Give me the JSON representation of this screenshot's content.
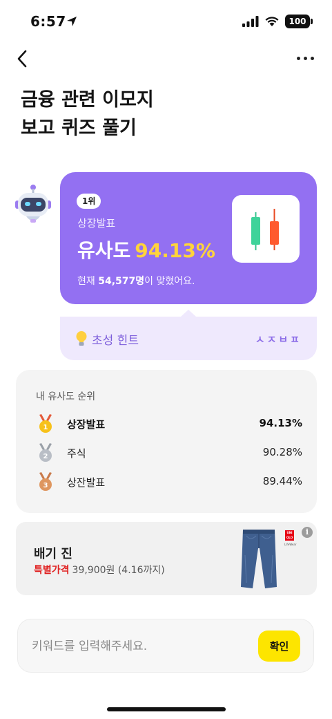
{
  "status_bar": {
    "time": "6:57",
    "battery": "100"
  },
  "nav": {
    "back_icon": "chevron-left-icon",
    "more_icon": "more-horizontal-icon"
  },
  "title": {
    "line1": "금융 관련 이모지",
    "line2": "보고 퀴즈 풀기"
  },
  "result": {
    "rank_badge": "1위",
    "word": "상장발표",
    "similarity_label": "유사도",
    "similarity_value": "94.13%",
    "solved_prefix": "현재 ",
    "solved_count": "54,577명",
    "solved_suffix": "이 맞혔어요.",
    "emoji": "candlestick-chart-emoji",
    "colors": {
      "card": "#9370f2",
      "highlight": "#ffd43b"
    }
  },
  "hint": {
    "label": "초성 힌트",
    "value": "ㅅㅈㅂㅍ",
    "icon": "lightbulb-icon"
  },
  "ranking": {
    "title": "내 유사도 순위",
    "items": [
      {
        "rank": "1",
        "word": "상장발표",
        "score": "94.13%",
        "medal": "gold-medal-icon"
      },
      {
        "rank": "2",
        "word": "주식",
        "score": "90.28%",
        "medal": "silver-medal-icon"
      },
      {
        "rank": "3",
        "word": "상잔발표",
        "score": "89.44%",
        "medal": "bronze-medal-icon"
      }
    ]
  },
  "ad": {
    "title": "배기 진",
    "price_tag": "특별가격",
    "price_rest": "39,900원 (4.16까지)",
    "brand_logo": "UNI QLO",
    "brand_sub": "LifeWear",
    "info_icon": "i"
  },
  "input": {
    "placeholder": "키워드를 입력해주세요.",
    "value": "",
    "submit_label": "확인"
  }
}
